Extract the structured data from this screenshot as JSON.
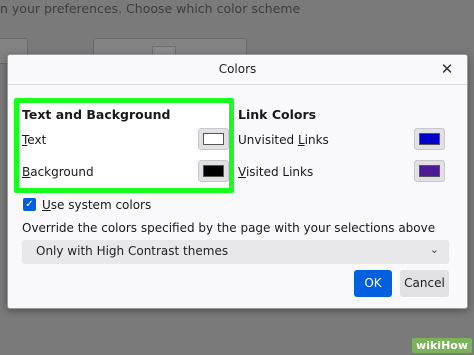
{
  "background": {
    "text": "n your preferences. Choose which color scheme"
  },
  "dialog": {
    "title": "Colors",
    "close_icon": "close-icon",
    "text_bg": {
      "heading": "Text and Background",
      "text_label": "Text",
      "text_color": "#ffffff",
      "background_label": "Background",
      "background_color": "#000000"
    },
    "links": {
      "heading": "Link Colors",
      "unvisited_label": "Unvisited Links",
      "unvisited_color": "#0000c8",
      "visited_label": "Visited Links",
      "visited_color": "#4b1b96"
    },
    "use_system_colors": {
      "label": "Use system colors",
      "checked": true
    },
    "override": {
      "label": "Override the colors specified by the page with your selections above",
      "selected": "Only with High Contrast themes"
    },
    "ok_label": "OK",
    "cancel_label": "Cancel"
  },
  "watermark": "wikiHow",
  "colors": {
    "accent": "#0060df",
    "highlight": "#16ff1f"
  }
}
